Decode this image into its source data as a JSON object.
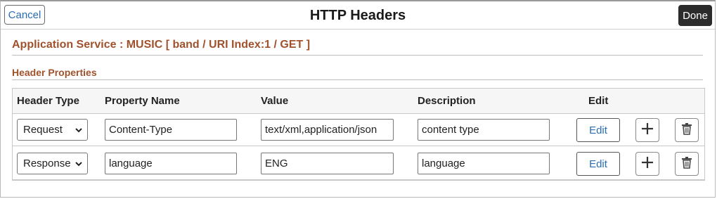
{
  "header": {
    "cancel_label": "Cancel",
    "title": "HTTP Headers",
    "done_label": "Done"
  },
  "section_title": "Application Service : MUSIC [ band / URI Index:1 / GET ]",
  "subsection_title": "Header Properties",
  "columns": {
    "header_type": "Header Type",
    "property_name": "Property Name",
    "value": "Value",
    "description": "Description",
    "edit": "Edit"
  },
  "rows": [
    {
      "header_type": "Request",
      "property_name": "Content-Type",
      "value": "text/xml,application/json",
      "description": "content type",
      "edit_label": "Edit"
    },
    {
      "header_type": "Response",
      "property_name": "language",
      "value": "ENG",
      "description": "language",
      "edit_label": "Edit"
    }
  ],
  "icons": {
    "add": "plus-icon",
    "delete": "trash-icon",
    "dropdown": "chevron-down-icon"
  },
  "colors": {
    "section_title": "#a0522d",
    "link_blue": "#2a6db3",
    "done_bg": "#2b2b2b"
  }
}
